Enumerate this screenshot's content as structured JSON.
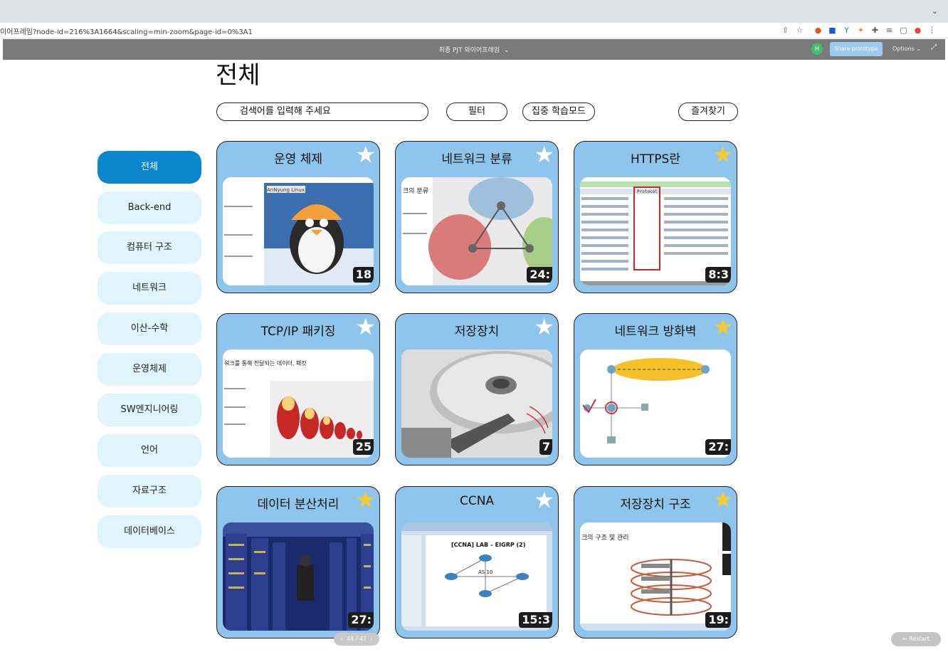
{
  "browser": {
    "url": "이어프레임?node-id=216%3A1664&scaling=min-zoom&page-id=0%3A1",
    "tab_menu_icon": "chevron-down-icon"
  },
  "prototype_bar": {
    "file_title": "최종 PJT 와이어프레임",
    "avatar_initial": "H",
    "share_label": "Share prototype",
    "options_label": "Options"
  },
  "page": {
    "title": "전체",
    "search_placeholder": "검색어를 입력해 주세요",
    "filter_label": "필터",
    "focus_mode_label": "집중 학습모드",
    "favorites_label": "즐겨찾기"
  },
  "sidebar": {
    "items": [
      {
        "label": "전체",
        "active": true
      },
      {
        "label": "Back-end",
        "active": false
      },
      {
        "label": "컴퓨터 구조",
        "active": false
      },
      {
        "label": "네트워크",
        "active": false
      },
      {
        "label": "이산-수학",
        "active": false
      },
      {
        "label": "운영체제",
        "active": false
      },
      {
        "label": "SW엔지니어링",
        "active": false
      },
      {
        "label": "언어",
        "active": false
      },
      {
        "label": "자료구조",
        "active": false
      },
      {
        "label": "데이터베이스",
        "active": false
      }
    ]
  },
  "cards": [
    {
      "title": "운영 체제",
      "favorite": false,
      "duration": "18",
      "thumb_text": "AnNyung Linux"
    },
    {
      "title": "네트워크 분류",
      "favorite": false,
      "duration": "24:",
      "thumb_text": "크의 분류"
    },
    {
      "title": "HTTPS란",
      "favorite": true,
      "duration": "8:3",
      "thumb_text": "Protocol"
    },
    {
      "title": "TCP/IP 패키징",
      "favorite": false,
      "duration": "25",
      "thumb_text": "워크를 통해 전달되는 데이터, 패킷"
    },
    {
      "title": "저장장치",
      "favorite": false,
      "duration": "7",
      "thumb_text": ""
    },
    {
      "title": "네트워크 방화벽",
      "favorite": true,
      "duration": "27:",
      "thumb_text": ""
    },
    {
      "title": "데이터 분산처리",
      "favorite": true,
      "duration": "27:",
      "thumb_text": ""
    },
    {
      "title": "CCNA",
      "favorite": false,
      "duration": "15:3",
      "thumb_text": "[CCNA] LAB – EIGRP (2)"
    },
    {
      "title": "저장장치 구조",
      "favorite": true,
      "duration": "19:",
      "thumb_text": "크의 구조 및 관리"
    }
  ],
  "footer": {
    "pager_label": "44 / 47",
    "restart_label": "Restart"
  }
}
